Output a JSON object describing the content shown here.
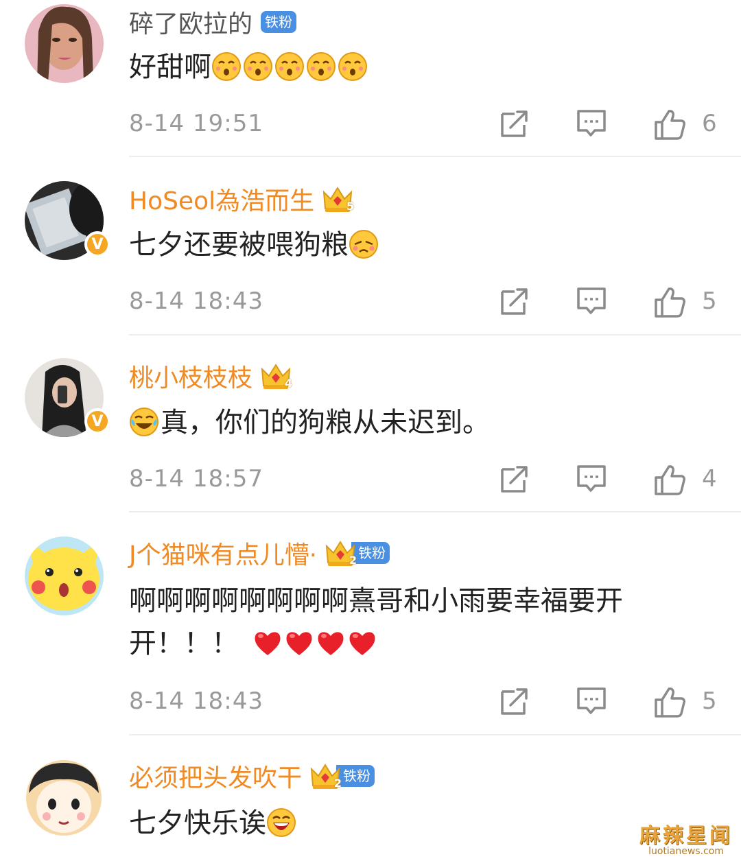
{
  "comments": [
    {
      "name": "碎了欧拉的",
      "badge": "铁粉",
      "text": "好甜啊",
      "time": "8-14 19:51",
      "likes": "6"
    },
    {
      "name": "HoSeol為浩而生",
      "crown_level": "5",
      "text": "七夕还要被喂狗粮",
      "time": "8-14 18:43",
      "likes": "5"
    },
    {
      "name": "桃小枝枝枝",
      "crown_level": "4",
      "text": "真，你们的狗粮从未迟到。",
      "time": "8-14 18:57",
      "likes": "4"
    },
    {
      "name": "J个猫咪有点儿懵·",
      "crown_level": "2",
      "badge": "铁粉",
      "text_line1": "啊啊啊啊啊啊啊啊熹哥和小雨要幸福要开",
      "text_line2": "开！！！",
      "time": "8-14 18:43",
      "likes": "5"
    },
    {
      "name": "必须把头发吹干",
      "crown_level": "2",
      "badge": "铁粉",
      "text": "七夕快乐诶",
      "time": "",
      "likes": ""
    }
  ],
  "watermark": {
    "title": "麻辣星闻",
    "url": "luotianews.com"
  },
  "colors": {
    "name_orange": "#f08a24",
    "badge_blue": "#4a90e2",
    "verified": "#f5a623"
  }
}
